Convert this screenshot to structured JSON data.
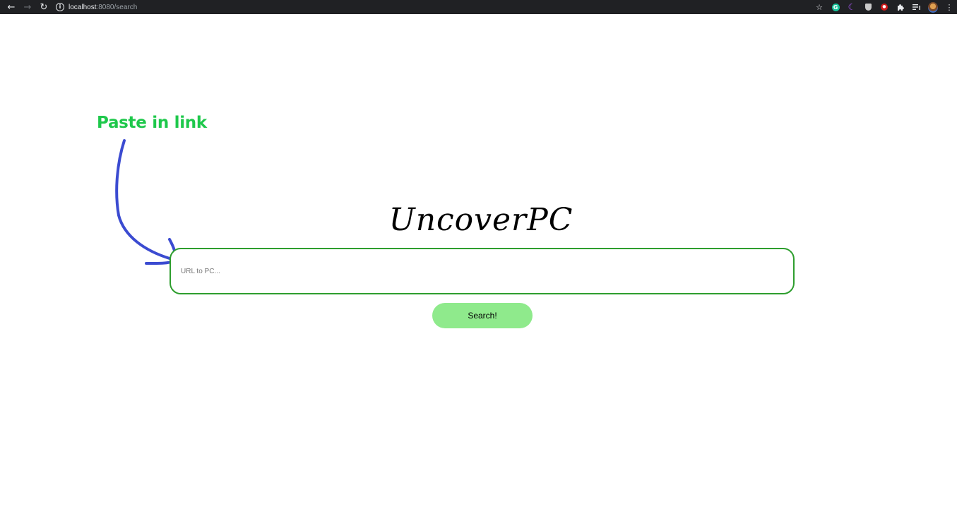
{
  "browser": {
    "url_host": "localhost",
    "url_path": ":8080/search",
    "icons": [
      "back-icon",
      "forward-icon",
      "reload-icon",
      "site-info-icon",
      "bookmark-star-icon",
      "grammarly-extension-icon",
      "dark-mode-extension-icon",
      "shield-extension-icon",
      "red-extension-icon",
      "extensions-puzzle-icon",
      "reading-list-icon",
      "profile-avatar",
      "menu-kebab-icon"
    ]
  },
  "annotation": {
    "label": "Paste in link",
    "label_color": "#1ec84b",
    "arrow_color": "#3b4bd1"
  },
  "logo": {
    "text": "UncoverPC"
  },
  "search": {
    "placeholder": "URL to PC...",
    "value": "",
    "border_color": "#2e9e2e",
    "button_label": "Search!",
    "button_color": "#8fea8c"
  }
}
